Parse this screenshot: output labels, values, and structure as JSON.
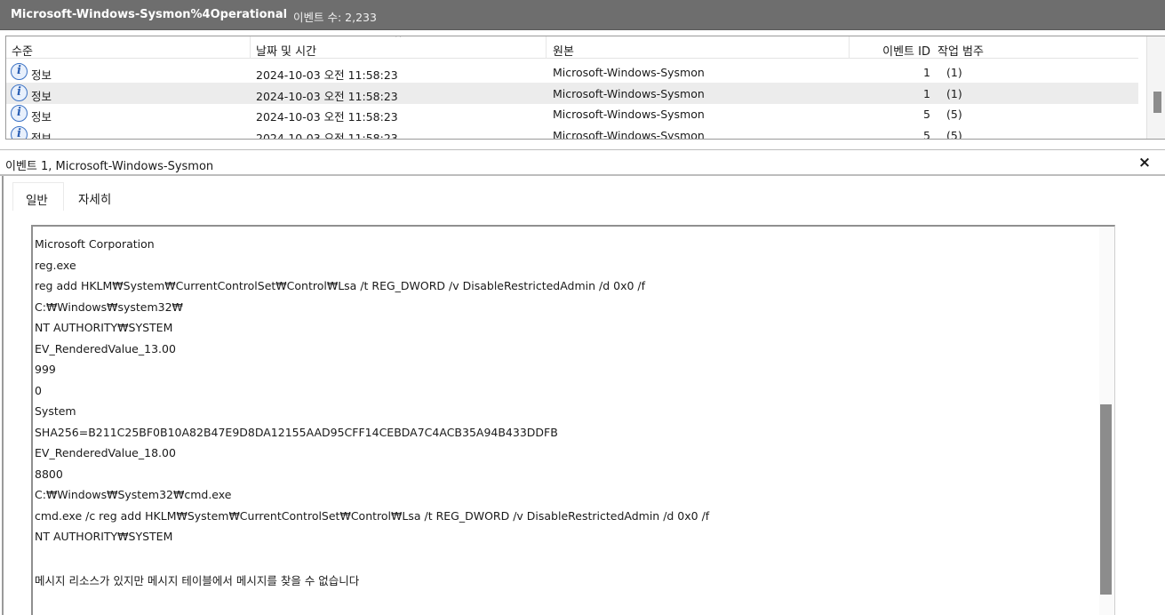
{
  "titlebar": {
    "log_name": "Microsoft-Windows-Sysmon%4Operational",
    "event_count": "이벤트 수: 2,233"
  },
  "list": {
    "columns": {
      "level": "수준",
      "datetime": "날짜 및 시간",
      "source": "원본",
      "event_id": "이벤트 ID",
      "task": "작업 범주"
    },
    "rows": [
      {
        "icon": "info-icon",
        "level": "정보",
        "datetime": "2024-10-03 오전 11:58:23",
        "source": "Microsoft-Windows-Sysmon",
        "event_id": "1",
        "task": "(1)",
        "selected": false
      },
      {
        "icon": "info-icon",
        "level": "정보",
        "datetime": "2024-10-03 오전 11:58:23",
        "source": "Microsoft-Windows-Sysmon",
        "event_id": "1",
        "task": "(1)",
        "selected": true
      },
      {
        "icon": "info-icon",
        "level": "정보",
        "datetime": "2024-10-03 오전 11:58:23",
        "source": "Microsoft-Windows-Sysmon",
        "event_id": "5",
        "task": "(5)",
        "selected": false
      },
      {
        "icon": "info-icon",
        "level": "정보",
        "datetime": "2024-10-03 오전 11:58:23",
        "source": "Microsoft-Windows-Sysmon",
        "event_id": "5",
        "task": "(5)",
        "selected": false
      }
    ]
  },
  "detail": {
    "title": "이벤트 1, Microsoft-Windows-Sysmon",
    "close_glyph": "×",
    "tabs": [
      "일반",
      "자세히"
    ],
    "lines": [
      "Microsoft Corporation",
      "reg.exe",
      "reg  add HKLM₩System₩CurrentControlSet₩Control₩Lsa /t REG_DWORD /v DisableRestrictedAdmin /d 0x0 /f",
      "C:₩Windows₩system32₩",
      "NT AUTHORITY₩SYSTEM",
      "EV_RenderedValue_13.00",
      "999",
      "0",
      "System",
      "SHA256=B211C25BF0B10A82B47E9D8DA12155AAD95CFF14CEBDA7C4ACB35A94B433DDFB",
      "EV_RenderedValue_18.00",
      "8800",
      "C:₩Windows₩System32₩cmd.exe",
      "cmd.exe /c reg add HKLM₩System₩CurrentControlSet₩Control₩Lsa /t REG_DWORD /v DisableRestrictedAdmin /d 0x0 /f",
      "NT AUTHORITY₩SYSTEM",
      "",
      "메시지 리소스가 있지만 메시지 테이블에서 메시지를 찾을 수 없습니다"
    ]
  }
}
